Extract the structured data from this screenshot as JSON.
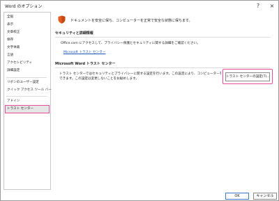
{
  "window": {
    "title": "Word のオプション",
    "help_icon": "?",
    "close_icon": "×"
  },
  "sidebar": {
    "items": [
      {
        "label": "全般"
      },
      {
        "label": "表示"
      },
      {
        "label": "文章校正"
      },
      {
        "label": "保存"
      },
      {
        "label": "文字体裁"
      },
      {
        "label": "言語"
      },
      {
        "label": "アクセシビリティ"
      },
      {
        "label": "詳細設定"
      },
      {
        "label": "リボンのユーザー設定"
      },
      {
        "label": "クイック アクセス ツール バー"
      },
      {
        "label": "アドイン"
      },
      {
        "label": "トラスト センター",
        "active": true
      }
    ]
  },
  "main": {
    "header_text": "ドキュメントを安全に保ち、コンピューターを正常で安全な状態に保ちます。",
    "security_section": {
      "title": "セキュリティと詳細情報",
      "description": "Office.com にアクセスして、プライバシー保護とセキュリティに関する詳細をご確認ください。",
      "link": "Microsoft トラスト センター"
    },
    "trust_center_section": {
      "title": "Microsoft Word トラスト センター",
      "description_line1": "トラスト センターではセキュリティとプライバシーに関する設定を行います。この設定により、コンピューターを保護することが",
      "description_line2": "できます。この設定は変更しないことをお勧めします。",
      "button": "トラスト センターの設定(T)..."
    }
  },
  "footer": {
    "ok": "OK",
    "cancel": "キャンセル"
  },
  "colors": {
    "highlight": "#e64b9c",
    "link": "#1a56b8",
    "shield_orange": "#e35b1f"
  }
}
